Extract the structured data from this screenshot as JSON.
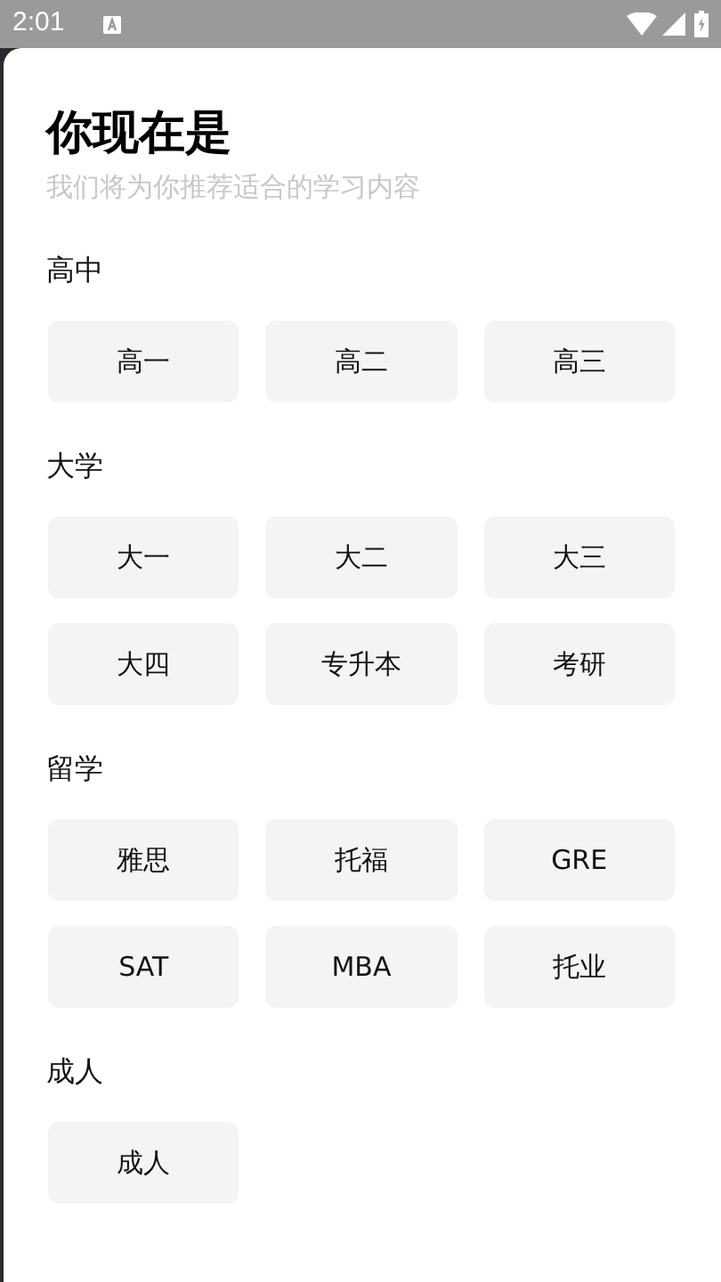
{
  "status_bar": {
    "time": "2:01"
  },
  "title": "你现在是",
  "subtitle": "我们将为你推荐适合的学习内容",
  "sections": [
    {
      "label": "高中",
      "options": [
        "高一",
        "高二",
        "高三"
      ]
    },
    {
      "label": "大学",
      "options": [
        "大一",
        "大二",
        "大三",
        "大四",
        "专升本",
        "考研"
      ]
    },
    {
      "label": "留学",
      "options": [
        "雅思",
        "托福",
        "GRE",
        "SAT",
        "MBA",
        "托业"
      ]
    },
    {
      "label": "成人",
      "options": [
        "成人"
      ]
    }
  ]
}
